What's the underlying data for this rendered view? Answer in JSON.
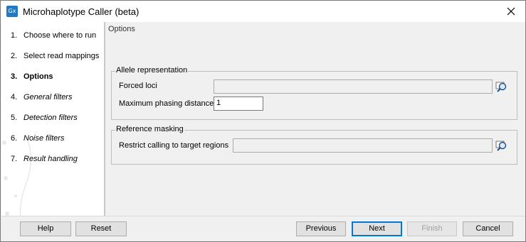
{
  "window": {
    "title": "Microhaplotype Caller (beta)",
    "icon_text": "Gx",
    "icon": "app-icon",
    "close_icon": "close-icon"
  },
  "steps": [
    {
      "num": "1.",
      "label": "Choose where to run",
      "state": "normal"
    },
    {
      "num": "2.",
      "label": "Select read mappings",
      "state": "normal"
    },
    {
      "num": "3.",
      "label": "Options",
      "state": "active"
    },
    {
      "num": "4.",
      "label": "General filters",
      "state": "italic"
    },
    {
      "num": "5.",
      "label": "Detection filters",
      "state": "italic"
    },
    {
      "num": "6.",
      "label": "Noise filters",
      "state": "italic"
    },
    {
      "num": "7.",
      "label": "Result handling",
      "state": "italic"
    }
  ],
  "content": {
    "title": "Options",
    "allele_group": {
      "legend": "Allele representation",
      "forced_loci_label": "Forced loci",
      "forced_loci_value": "",
      "max_phasing_label": "Maximum phasing distance",
      "max_phasing_value": "1"
    },
    "masking_group": {
      "legend": "Reference masking",
      "restrict_label": "Restrict calling to target regions",
      "restrict_value": ""
    }
  },
  "buttons": {
    "help": "Help",
    "reset": "Reset",
    "previous": "Previous",
    "next": "Next",
    "finish": "Finish",
    "cancel": "Cancel"
  },
  "colors": {
    "accent": "#0078d7",
    "app_icon": "#1f7bc6",
    "disabled_text": "#a0a0a0"
  }
}
